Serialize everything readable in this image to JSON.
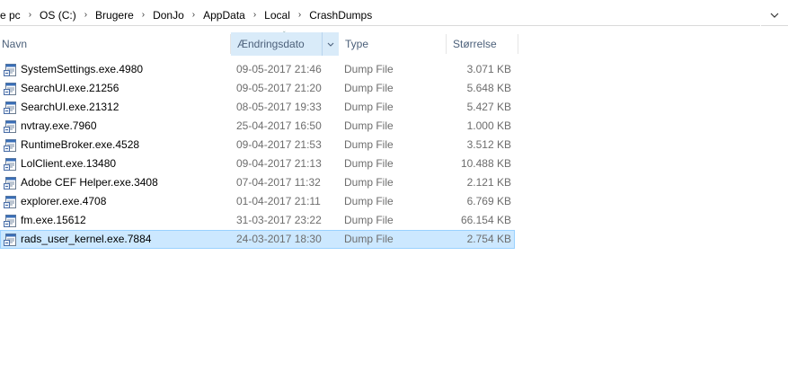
{
  "breadcrumb": [
    "e pc",
    "OS (C:)",
    "Brugere",
    "DonJo",
    "AppData",
    "Local",
    "CrashDumps"
  ],
  "columns": {
    "name": "Navn",
    "date": "Ændringsdato",
    "type": "Type",
    "size": "Størrelse"
  },
  "files": [
    {
      "name": "SystemSettings.exe.4980",
      "date": "09-05-2017 21:46",
      "type": "Dump File",
      "size": "3.071 KB"
    },
    {
      "name": "SearchUI.exe.21256",
      "date": "09-05-2017 21:20",
      "type": "Dump File",
      "size": "5.648 KB"
    },
    {
      "name": "SearchUI.exe.21312",
      "date": "08-05-2017 19:33",
      "type": "Dump File",
      "size": "5.427 KB"
    },
    {
      "name": "nvtray.exe.7960",
      "date": "25-04-2017 16:50",
      "type": "Dump File",
      "size": "1.000 KB"
    },
    {
      "name": "RuntimeBroker.exe.4528",
      "date": "09-04-2017 21:53",
      "type": "Dump File",
      "size": "3.512 KB"
    },
    {
      "name": "LolClient.exe.13480",
      "date": "09-04-2017 21:13",
      "type": "Dump File",
      "size": "10.488 KB"
    },
    {
      "name": "Adobe CEF Helper.exe.3408",
      "date": "07-04-2017 11:32",
      "type": "Dump File",
      "size": "2.121 KB"
    },
    {
      "name": "explorer.exe.4708",
      "date": "01-04-2017 21:11",
      "type": "Dump File",
      "size": "6.769 KB"
    },
    {
      "name": "fm.exe.15612",
      "date": "31-03-2017 23:22",
      "type": "Dump File",
      "size": "66.154 KB"
    },
    {
      "name": "rads_user_kernel.exe.7884",
      "date": "24-03-2017 18:30",
      "type": "Dump File",
      "size": "2.754 KB"
    }
  ],
  "selected_index": 9,
  "colors": {
    "selection_bg": "#cce8ff",
    "selection_border": "#99d1ff",
    "sorted_header_bg": "#d9ebf9",
    "header_text": "#4c607a",
    "secondary_text": "#6d6d6d"
  },
  "icons": {
    "file": "dump-file-icon",
    "address_dropdown": "chevron-down-icon",
    "sort": "sort-ascending-icon"
  }
}
